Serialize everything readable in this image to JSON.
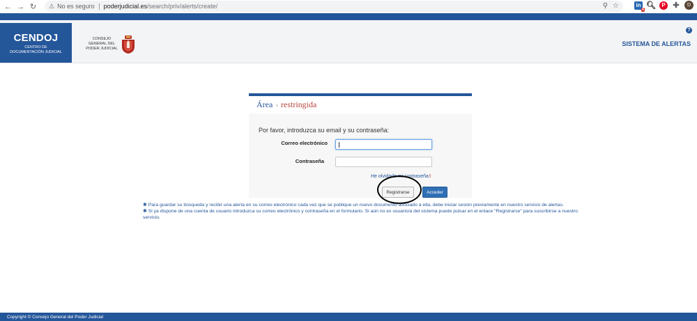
{
  "browser": {
    "back_icon": "←",
    "forward_icon": "→",
    "reload_icon": "↻",
    "security_label": "No es seguro",
    "url_host": "poderjudicial.es",
    "url_path": "/search/priv/alerts/create/",
    "profile_initial": "D",
    "extension_badge": "6"
  },
  "header": {
    "logo_title": "CENDOJ",
    "logo_subtitle_1": "CENTRO DE",
    "logo_subtitle_2": "DOCUMENTACIÓN JUDICIAL",
    "cgpj_line1": "CONSEJO",
    "cgpj_line2": "GENERAL DEL",
    "cgpj_line3": "PODER JUDICIAL",
    "help_label": "?",
    "system_title": "SISTEMA DE ALERTAS"
  },
  "login": {
    "breadcrumb_area": "Área",
    "breadcrumb_sep": "›",
    "breadcrumb_restricted": "restringida",
    "intro": "Por favor, introduzca su email y su contraseña:",
    "email_label": "Correo electrónico",
    "email_value": "",
    "password_label": "Contraseña",
    "password_value": "",
    "forgot_link": "He olvidado mi contraseña",
    "forgot_mark": "!",
    "register_button": "Registrarse",
    "access_button": "Acceder"
  },
  "notes": {
    "star": "✱",
    "note1": "Para guardar su búsqueda y recibir una alerta en su correo electrónico cada vez que se publique un nuevo documento asociado a ella, debe iniciar sesión previamente en nuestro servicio de alertas.",
    "note2": "Si ya dispone de una cuenta de usuario introduzca su correo electrónico y contraseña en el formulario. Si aún no es usuario/a del sistema puede pulsar en el enlace \"Registrarse\" para suscribirse a nuestro servicio."
  },
  "footer": {
    "copyright": "Copyright © Consejo General del Poder Judicial"
  },
  "colors": {
    "brand_blue": "#24569a",
    "accent_red": "#b5443b"
  }
}
